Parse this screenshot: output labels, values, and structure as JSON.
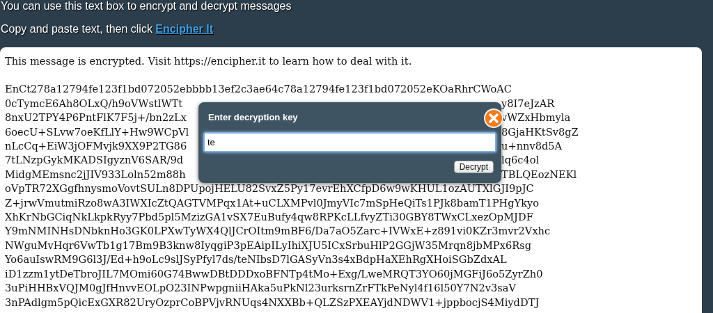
{
  "page": {
    "intro": "You can use this text box to encrypt and decrypt messages",
    "instruction": "Copy and paste text, then click ",
    "link": "Encipher It"
  },
  "message": {
    "notice": "This message is encrypted. Visit https://encipher.it to learn how to deal with it.",
    "lines": [
      {
        "text": "EnCt278a12794fe123f1bd072052ebbbb13ef2c3ae64c78a12794fe123f1bd072052eKOaRhrCWoAC"
      },
      {
        "left": "0cTymcE6Ah8OLxQ/h9oVWstlWTt",
        "right": "y8I7eJzAR"
      },
      {
        "left": "8nxU2TPY4P6PntFlK7F5j+/bn2zLx",
        "right": "vWZxHbmyla"
      },
      {
        "left": "6oecU+SLvw7oeKfLlY+Hw9WCpVl",
        "right": "8GjaHKtSv8gZ"
      },
      {
        "left": "nLcCq+EiW3jOFMvjk9XX9P2TG86",
        "right": "u+nnv8d5A"
      },
      {
        "left": "7tLNzpGykMKADSIgyznV6SAR/9d",
        "right": "lq6c4ol"
      },
      {
        "left": "MidgMEmsnc2jJIV933Loln52m88h",
        "right": "TBLQEozNEKl"
      },
      {
        "text": "oVpTR72XGgfhnysmoVovtSULn8DPUpojHELU82SvxZ5Py17evrEhXCfpD6w9wKHUL1ozAUTXlGJI9pJC"
      },
      {
        "text": "Z+jrwVmutmiRzo8wA3IWXIcZtQAGTVMPqx1At+uCLXMPvl0JmyVIc7mSpHeQiTs1PJk8bamT1PHgYkyo"
      },
      {
        "text": "XhKrNbGCiqNkLkpkRyy7Pbd5pl5MzizGA1vSX7EuBufy4qw8RPKcLLfvyZTi30GBY8TWxCLxezOpMJDF"
      },
      {
        "text": "Y9mNMINHsDNbknHo3GK0LPXwTyWX4QlJCrOItm9mBF6/Da7aO5Zarc+IVWxE+z891vi0KZr3mvr2Vxhc"
      },
      {
        "text": "NWguMvHqr6VwTb1g17Bm9B3knw8IyqgiP3pEAipILyIhiXJU5ICxSrbuHlP2GGjW35Mrqn8jbMPx6Rsg"
      },
      {
        "text": "Yo6auIswRM9G6l3J/Ed+h9oLc9slJSyPfyl7ds/teNIbsD7lGASyVn3s4xBdpHaXEhRgXHoiSGbZdxAL"
      },
      {
        "text": "iD1zzm1ytDeTbroJIL7MOmi60G74BwwDBtDDDxoBFNTp4tMo+Exg/LweMRQT3YO60jMGFiJ6o5ZyrZh0"
      },
      {
        "text": "3uPiHHBxVQJM0gJfHnvvEOLpO23INPwpgniiHAka5uPkNl23urksrnZrFTkPeNyl4f16l50Y7N2v3saV"
      },
      {
        "text": "3nPAdlgm5pQicExGXR82UryOzprCoBPVjvRNUqs4NXXBb+QLZSzPXEAYjdNDWV1+jppbocjS4MiydDTJ"
      }
    ]
  },
  "dialog": {
    "title": "Enter decryption key",
    "key_field": {
      "value": "te"
    },
    "button": "Decrypt"
  }
}
